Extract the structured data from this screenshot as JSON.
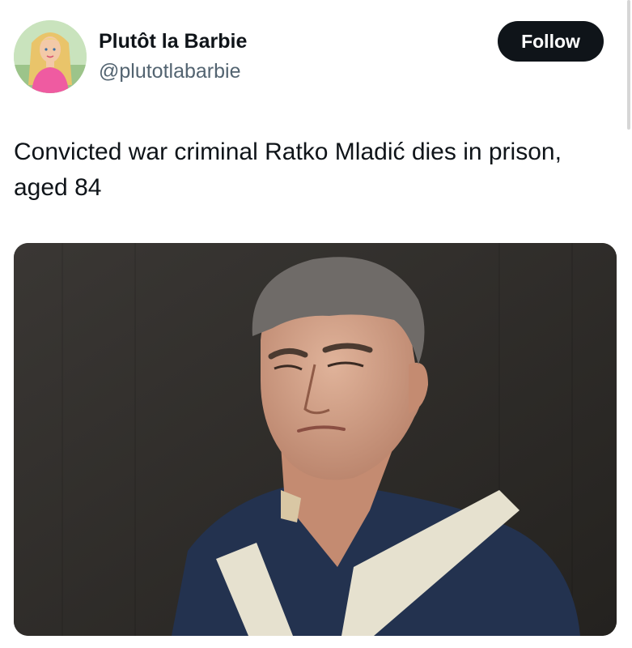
{
  "author": {
    "display_name": "Plutôt la Barbie",
    "handle": "@plutotlabarbie",
    "avatar_icon": "profile-avatar-barbie"
  },
  "actions": {
    "follow_label": "Follow"
  },
  "tweet": {
    "text": "Convicted war criminal Ratko Mladić dies in prison, aged 84"
  },
  "media": {
    "type": "photo",
    "alt_icon": "photo-portrait-man"
  },
  "colors": {
    "text_primary": "#0f1419",
    "text_secondary": "#536471",
    "follow_bg": "#0f1419",
    "follow_text": "#ffffff",
    "background": "#ffffff"
  }
}
